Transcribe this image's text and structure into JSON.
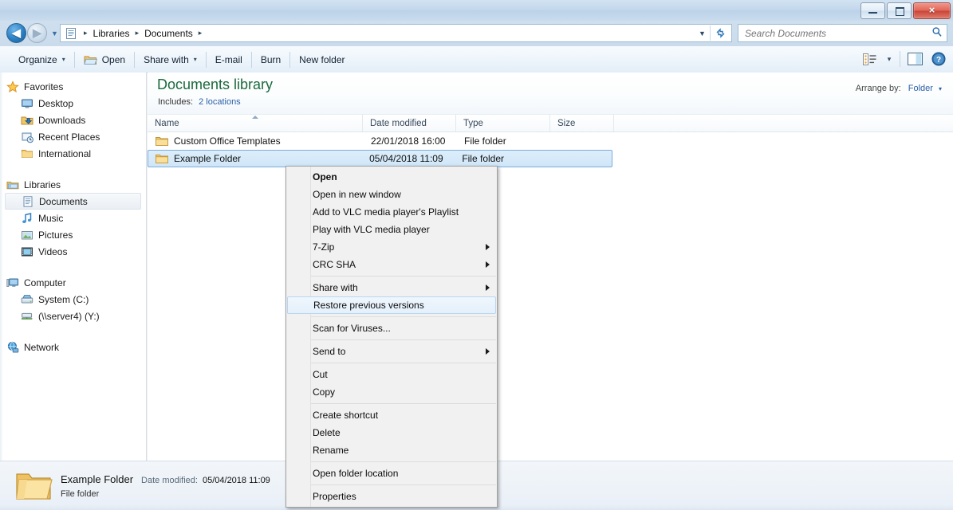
{
  "window": {
    "minimize_label": "Minimize",
    "maximize_label": "Maximize",
    "close_label": "×"
  },
  "address_bar": {
    "back_glyph": "◀",
    "forward_glyph": "▶",
    "history_caret": "▼",
    "breadcrumbs": [
      "Libraries",
      "Documents"
    ],
    "separator": "▸",
    "dropdown_caret": "▼",
    "refresh_glyph": "↻"
  },
  "search": {
    "placeholder": "Search Documents",
    "icon": "search-icon",
    "icon_glyph": "⚲"
  },
  "toolbar": {
    "items": [
      {
        "label": "Organize",
        "caret": "▾",
        "icon": null
      },
      {
        "label": "Open",
        "caret": "",
        "icon": "open-folder-icon"
      },
      {
        "label": "Share with",
        "caret": "▾",
        "icon": null
      },
      {
        "label": "E-mail",
        "caret": "",
        "icon": null
      },
      {
        "label": "Burn",
        "caret": "",
        "icon": null
      },
      {
        "label": "New folder",
        "caret": "",
        "icon": null
      }
    ],
    "view_caret": "▾",
    "help_glyph": "?"
  },
  "sidebar": {
    "groups": [
      {
        "header": {
          "label": "Favorites",
          "icon": "star-icon"
        },
        "items": [
          {
            "label": "Desktop",
            "icon": "desktop-icon"
          },
          {
            "label": "Downloads",
            "icon": "downloads-icon"
          },
          {
            "label": "Recent Places",
            "icon": "recent-places-icon"
          },
          {
            "label": "International",
            "icon": "folder-icon"
          }
        ]
      },
      {
        "header": {
          "label": "Libraries",
          "icon": "libraries-icon"
        },
        "items": [
          {
            "label": "Documents",
            "icon": "documents-icon",
            "selected": true
          },
          {
            "label": "Music",
            "icon": "music-icon"
          },
          {
            "label": "Pictures",
            "icon": "pictures-icon"
          },
          {
            "label": "Videos",
            "icon": "videos-icon"
          }
        ]
      },
      {
        "header": {
          "label": "Computer",
          "icon": "computer-icon"
        },
        "items": [
          {
            "label": "System (C:)",
            "icon": "drive-icon"
          },
          {
            "label": "(\\\\server4) (Y:)",
            "icon": "network-drive-icon"
          }
        ]
      },
      {
        "header": {
          "label": "Network",
          "icon": "network-icon"
        },
        "items": []
      }
    ]
  },
  "library": {
    "title": "Documents library",
    "includes_label": "Includes:",
    "includes_link": "2 locations",
    "arrange_label": "Arrange by:",
    "arrange_value": "Folder",
    "arrange_caret": "▾"
  },
  "columns": [
    {
      "key": "name",
      "label": "Name",
      "sorted": true
    },
    {
      "key": "date",
      "label": "Date modified",
      "sorted": false
    },
    {
      "key": "type",
      "label": "Type",
      "sorted": false
    },
    {
      "key": "size",
      "label": "Size",
      "sorted": false
    }
  ],
  "files": [
    {
      "name": "Custom Office Templates",
      "date": "22/01/2018 16:00",
      "type": "File folder",
      "size": "",
      "selected": false
    },
    {
      "name": "Example Folder",
      "date": "05/04/2018 11:09",
      "type": "File folder",
      "size": "",
      "selected": true
    }
  ],
  "details_pane": {
    "name": "Example Folder",
    "date_label": "Date modified:",
    "date_value": "05/04/2018 11:09",
    "type": "File folder",
    "icon": "large-folder-icon"
  },
  "context_menu": {
    "items": [
      {
        "label": "Open",
        "bold": true,
        "submenu": false,
        "highlighted": false
      },
      {
        "label": "Open in new window",
        "bold": false,
        "submenu": false,
        "highlighted": false
      },
      {
        "label": "Add to VLC media player's Playlist",
        "bold": false,
        "submenu": false,
        "highlighted": false
      },
      {
        "label": "Play with VLC media player",
        "bold": false,
        "submenu": false,
        "highlighted": false
      },
      {
        "label": "7-Zip",
        "bold": false,
        "submenu": true,
        "highlighted": false
      },
      {
        "label": "CRC SHA",
        "bold": false,
        "submenu": true,
        "highlighted": false
      },
      {
        "separator": true
      },
      {
        "label": "Share with",
        "bold": false,
        "submenu": true,
        "highlighted": false
      },
      {
        "label": "Restore previous versions",
        "bold": false,
        "submenu": false,
        "highlighted": true
      },
      {
        "separator": true
      },
      {
        "label": "Scan for Viruses...",
        "bold": false,
        "submenu": false,
        "highlighted": false
      },
      {
        "separator": true
      },
      {
        "label": "Send to",
        "bold": false,
        "submenu": true,
        "highlighted": false
      },
      {
        "separator": true
      },
      {
        "label": "Cut",
        "bold": false,
        "submenu": false,
        "highlighted": false
      },
      {
        "label": "Copy",
        "bold": false,
        "submenu": false,
        "highlighted": false
      },
      {
        "separator": true
      },
      {
        "label": "Create shortcut",
        "bold": false,
        "submenu": false,
        "highlighted": false
      },
      {
        "label": "Delete",
        "bold": false,
        "submenu": false,
        "highlighted": false
      },
      {
        "label": "Rename",
        "bold": false,
        "submenu": false,
        "highlighted": false
      },
      {
        "separator": true
      },
      {
        "label": "Open folder location",
        "bold": false,
        "submenu": false,
        "highlighted": false
      },
      {
        "separator": true
      },
      {
        "label": "Properties",
        "bold": false,
        "submenu": false,
        "highlighted": false
      }
    ]
  },
  "colors": {
    "library_title": "#1b6a3d",
    "link": "#2b5fa8",
    "selection_bg": "#cfe6f8",
    "selection_border": "#7aaddd",
    "menu_highlight": "#e4f0fb",
    "close_button": "#c94437"
  }
}
